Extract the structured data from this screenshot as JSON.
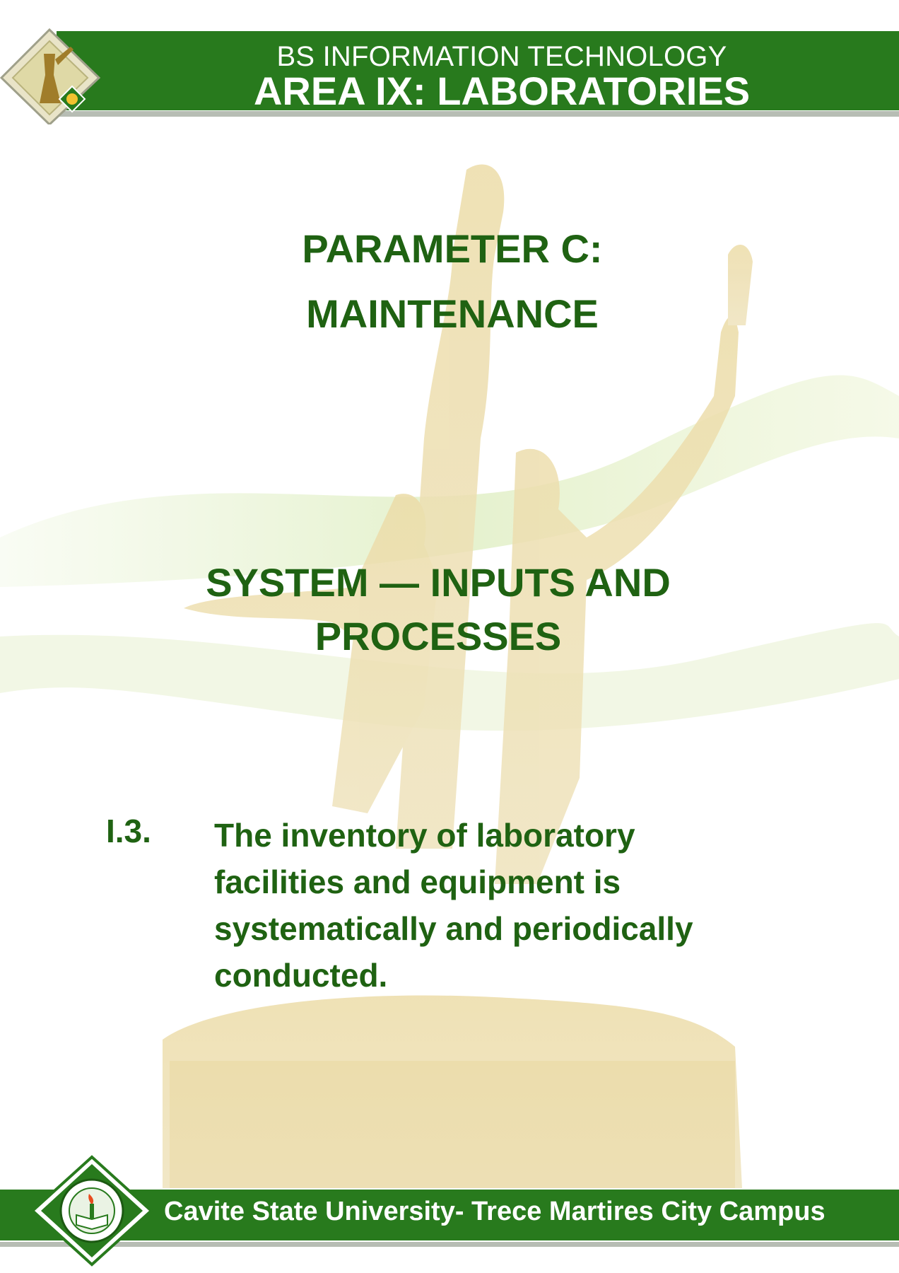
{
  "header": {
    "program": "BS INFORMATION TECHNOLOGY",
    "area": "AREA IX: LABORATORIES"
  },
  "parameter": {
    "line1": "PARAMETER C:",
    "line2": "MAINTENANCE"
  },
  "section": {
    "line1": "SYSTEM — INPUTS AND",
    "line2": "PROCESSES"
  },
  "item": {
    "number": "I.3.",
    "lines": [
      "The inventory of laboratory",
      "facilities and equipment is",
      "systematically and periodically",
      "conducted."
    ]
  },
  "footer": {
    "campus": "Cavite State University- Trece Martires City Campus"
  },
  "colors": {
    "brand_green": "#287a1d",
    "text_green": "#1f6212",
    "rule_gray": "#b7bdb4"
  },
  "icons": {
    "header_logo": "monument-diamond-logo-icon",
    "footer_logo": "university-seal-icon",
    "background": "monument-statue-watermark"
  }
}
